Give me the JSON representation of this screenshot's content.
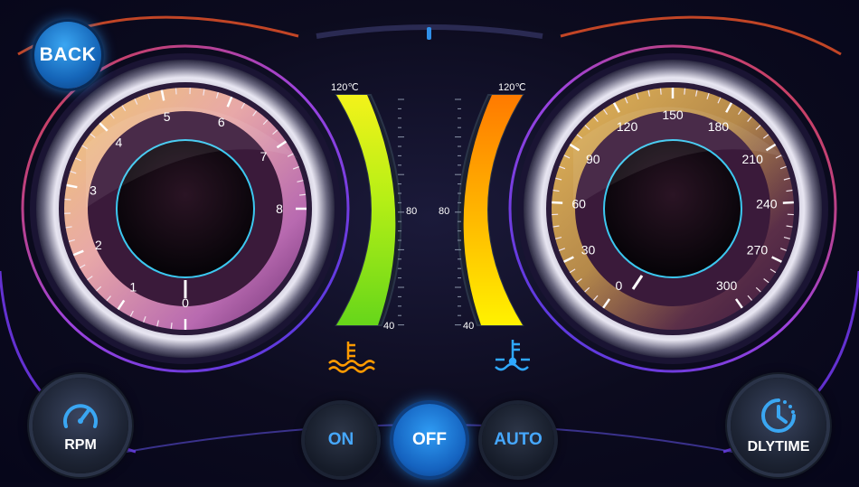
{
  "back_button": {
    "label": "BACK"
  },
  "rpm_gauge": {
    "ticks": [
      "0",
      "1",
      "2",
      "3",
      "4",
      "5",
      "6",
      "7",
      "8"
    ],
    "value": 0
  },
  "speed_gauge": {
    "ticks": [
      "0",
      "30",
      "60",
      "90",
      "120",
      "150",
      "180",
      "210",
      "240",
      "270",
      "300"
    ],
    "value": 0
  },
  "left_temp_bar": {
    "max_label": "120℃",
    "mid_label": "80",
    "min_label": "40",
    "level": 1.0
  },
  "right_temp_bar": {
    "max_label": "120℃",
    "mid_label": "80",
    "min_label": "40",
    "level": 1.0
  },
  "rpm_button": {
    "label": "RPM"
  },
  "dlytime_button": {
    "label": "DLYTIME"
  },
  "mode_buttons": {
    "on": "ON",
    "off": "OFF",
    "auto": "AUTO",
    "selected": "OFF"
  },
  "colors": {
    "accent": "#2f8fe8",
    "ring": "#3cc8f0",
    "warning_orange": "#ff9a00",
    "coolant_blue": "#2fa8ff"
  }
}
